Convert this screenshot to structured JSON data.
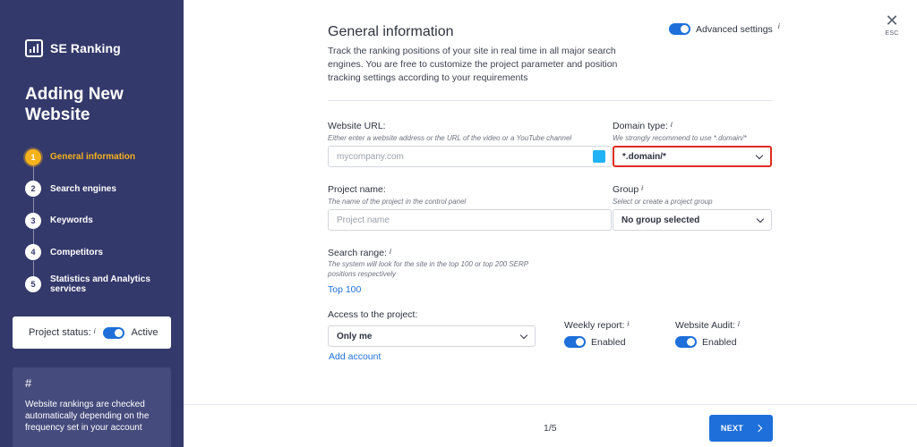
{
  "sidebar": {
    "logo_text": "SE Ranking",
    "title": "Adding New Website",
    "steps": [
      {
        "num": "1",
        "label": "General information"
      },
      {
        "num": "2",
        "label": "Search engines"
      },
      {
        "num": "3",
        "label": "Keywords"
      },
      {
        "num": "4",
        "label": "Competitors"
      },
      {
        "num": "5",
        "label": "Statistics and Analytics services"
      }
    ],
    "status_label": "Project status:",
    "status_info": "i",
    "status_value": "Active",
    "tip_symbol": "#",
    "tip_text": "Website rankings are checked automatically depending on the frequency set in your account"
  },
  "main": {
    "close_label": "ESC",
    "title": "General information",
    "description": "Track the ranking positions of your site in real time in all major search engines. You are free to customize the project parameter and position tracking settings according to your requirements",
    "advanced_label": "Advanced settings",
    "info": "i",
    "website_url": {
      "label": "Website URL:",
      "hint": "Either enter a website address or the URL of the video or a YouTube channel",
      "placeholder": "mycompany.com"
    },
    "domain_type": {
      "label": "Domain type:",
      "hint": "We strongly recommend to use *.domain/*",
      "value": "*.domain/*"
    },
    "project_name": {
      "label": "Project name:",
      "hint": "The name of the project in the control panel",
      "placeholder": "Project name"
    },
    "group": {
      "label": "Group",
      "hint": "Select or create a project group",
      "value": "No group selected"
    },
    "search_range": {
      "label": "Search range:",
      "hint": "The system will look for the site in the top 100 or top 200 SERP positions respectively",
      "value": "Top 100"
    },
    "access": {
      "label": "Access to the project:",
      "value": "Only me",
      "add_account": "Add account"
    },
    "weekly_report": {
      "label": "Weekly report:",
      "value": "Enabled"
    },
    "website_audit": {
      "label": "Website Audit:",
      "value": "Enabled"
    }
  },
  "footer": {
    "page_indicator": "1/5",
    "next_label": "NEXT"
  },
  "colors": {
    "sidebar_bg": "#34396b",
    "accent": "#1e6fd9",
    "active_step": "#f6b21a",
    "highlight": "#e02b20"
  }
}
